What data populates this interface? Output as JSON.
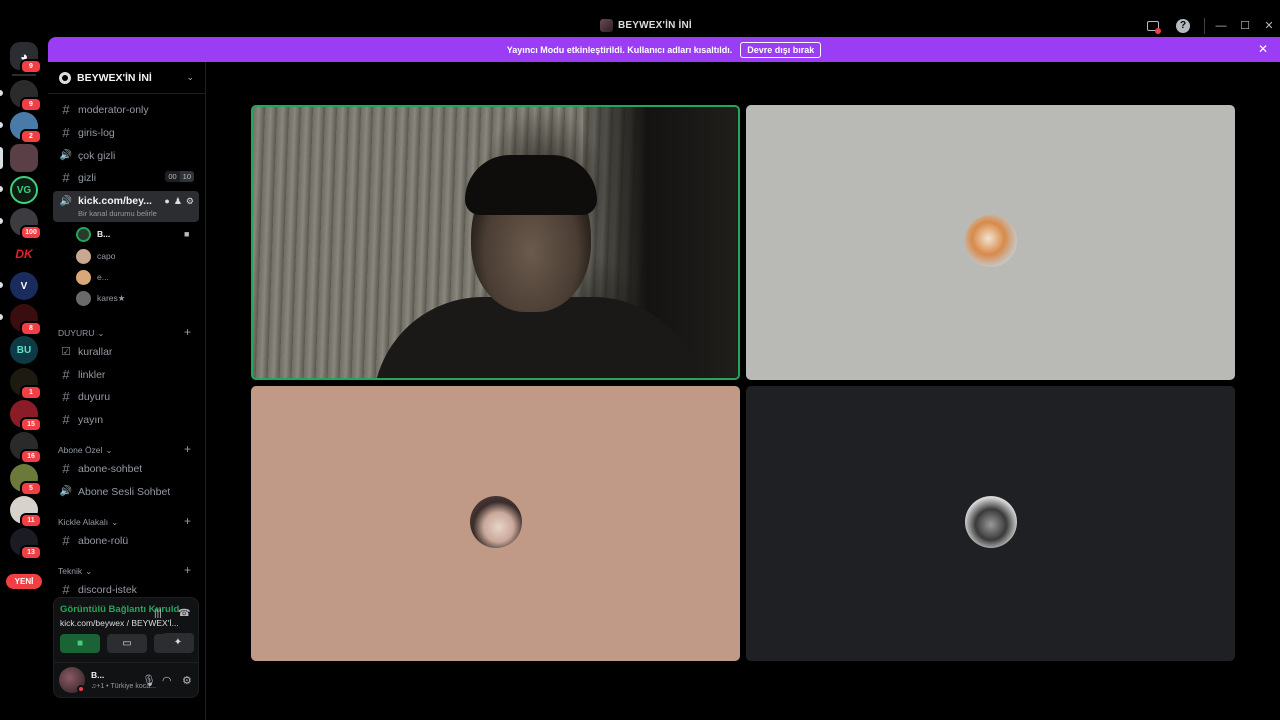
{
  "window": {
    "title": "BEYWEX'İN İNİ"
  },
  "colors": {
    "banner": "#9b3df5",
    "online_green": "#23a55a",
    "badge_red": "#f23f43"
  },
  "server_rail": {
    "badges": [
      "9",
      "9",
      "2",
      "",
      "",
      "100",
      "",
      "",
      "8",
      "",
      "1",
      "15",
      "16",
      "5",
      "11",
      "13"
    ],
    "new_label": "YENİ"
  },
  "banner": {
    "text": "Yayıncı Modu etkinleştirildi. Kullanıcı adları kısaltıldı.",
    "button": "Devre dışı bırak"
  },
  "sidebar": {
    "guild_name": "BEYWEX'İN İNİ",
    "channels_top": [
      {
        "name": "moderator-only",
        "icon": "#"
      },
      {
        "name": "giris-log",
        "icon": "#"
      },
      {
        "name": "çok gizli",
        "icon": "🔊"
      },
      {
        "name": "gizli",
        "icon": "#",
        "count_a": "00",
        "count_b": "10"
      }
    ],
    "active_voice": {
      "name": "kick.com/bey...",
      "status": "Bir kanal durumu belirle"
    },
    "voice_users": [
      "B...",
      "capo",
      "e...",
      "kares★"
    ],
    "categories": [
      {
        "name": "DUYURU",
        "channels": [
          {
            "name": "kurallar",
            "icon": "☑"
          },
          {
            "name": "linkler",
            "icon": "#"
          },
          {
            "name": "duyuru",
            "icon": "#"
          },
          {
            "name": "yayın",
            "icon": "#"
          }
        ]
      },
      {
        "name": "Abone Özel",
        "channels": [
          {
            "name": "abone-sohbet",
            "icon": "#"
          },
          {
            "name": "Abone Sesli Sohbet",
            "icon": "🔊"
          }
        ]
      },
      {
        "name": "Kickle Alakalı",
        "channels": [
          {
            "name": "abone-rolü",
            "icon": "#"
          }
        ]
      },
      {
        "name": "Teknik",
        "channels": [
          {
            "name": "discord-istek",
            "icon": "#"
          }
        ]
      }
    ]
  },
  "voice_panel": {
    "status": "Görüntülü Bağlantı Kuruld",
    "location": "kick.com/beywex / BEYWEX'İ..."
  },
  "user_panel": {
    "name": "B...",
    "status": "♫+1 • Türkiye koca..."
  },
  "icons": [
    "discord-logo-icon",
    "speaker-icon",
    "hash-icon",
    "camera-icon",
    "screen-share-icon",
    "gamepad-icon",
    "activity-icon",
    "mic-icon",
    "headphones-icon",
    "gear-icon",
    "hangup-icon",
    "help-icon"
  ]
}
